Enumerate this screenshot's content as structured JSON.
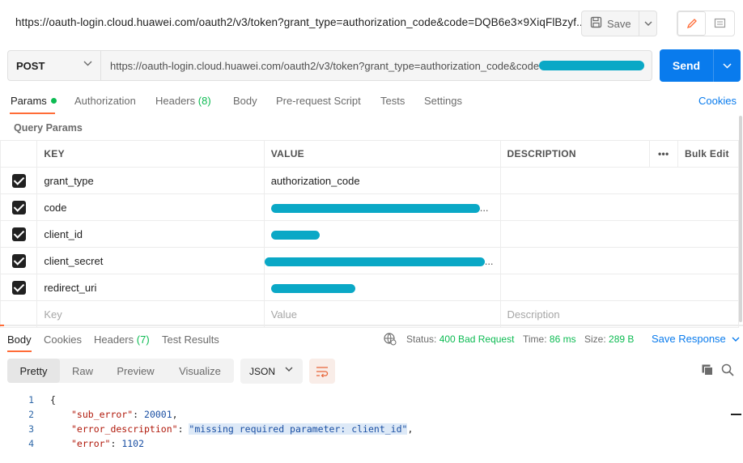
{
  "titlebar": {
    "request_title": "https://oauth-login.cloud.huawei.com/oauth2/v3/token?grant_type=authorization_code&code=DQB6e3×9XiqFlBzyf...",
    "save_label": "Save"
  },
  "request": {
    "method": "POST",
    "url": "https://oauth-login.cloud.huawei.com/oauth2/v3/token?grant_type=authorization_code&code",
    "send_label": "Send"
  },
  "request_tabs": {
    "params": "Params",
    "authorization": "Authorization",
    "headers": "Headers",
    "headers_count": "(8)",
    "body": "Body",
    "prerequest": "Pre-request Script",
    "tests": "Tests",
    "settings": "Settings",
    "cookies": "Cookies"
  },
  "query_params": {
    "title": "Query Params",
    "columns": {
      "key": "KEY",
      "value": "VALUE",
      "description": "DESCRIPTION",
      "more": "•••",
      "bulk_edit": "Bulk Edit"
    },
    "rows": [
      {
        "key": "grant_type",
        "value": "authorization_code",
        "checked": true
      },
      {
        "key": "code",
        "value": "...",
        "checked": true
      },
      {
        "key": "client_id",
        "value": "",
        "checked": true
      },
      {
        "key": "client_secret",
        "value": "...",
        "checked": true
      },
      {
        "key": "redirect_uri",
        "value": "",
        "checked": true
      }
    ],
    "placeholders": {
      "key": "Key",
      "value": "Value",
      "description": "Description"
    }
  },
  "response_tabs": {
    "body": "Body",
    "cookies": "Cookies",
    "headers": "Headers",
    "headers_count": "(7)",
    "test_results": "Test Results"
  },
  "response_meta": {
    "status_label": "Status:",
    "status_value": "400 Bad Request",
    "time_label": "Time:",
    "time_value": "86 ms",
    "size_label": "Size:",
    "size_value": "289 B",
    "save_response": "Save Response"
  },
  "body_view": {
    "formats": [
      "Pretty",
      "Raw",
      "Preview",
      "Visualize"
    ],
    "active_format": "Pretty",
    "language": "JSON"
  },
  "response_body": {
    "line_numbers": [
      "1",
      "2",
      "3",
      "4"
    ],
    "open_brace": "{",
    "sub_error_key": "\"sub_error\"",
    "sub_error_value": "20001",
    "error_description_key": "\"error_description\"",
    "error_description_value": "\"missing required parameter: client_id\"",
    "error_key": "\"error\"",
    "error_value": "1102"
  },
  "colors": {
    "accent_orange": "#ff6c37",
    "send_blue": "#097bed",
    "success_green": "#0cbb52",
    "redaction_cyan": "#0aa8c6"
  }
}
